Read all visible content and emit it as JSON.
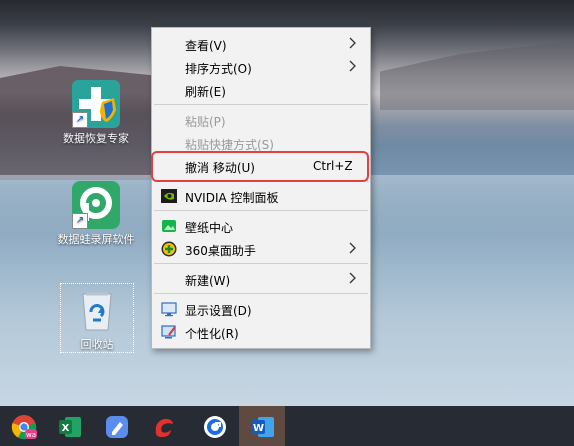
{
  "desktop_icons": [
    {
      "label": "数据恢复专家",
      "icon": "data-recovery-icon"
    },
    {
      "label": "数据蛙录屏软件",
      "icon": "screen-recorder-icon"
    },
    {
      "label": "回收站",
      "icon": "recycle-bin-icon"
    }
  ],
  "context_menu": {
    "view": "查看(V)",
    "sort": "排序方式(O)",
    "refresh": "刷新(E)",
    "paste": "粘贴(P)",
    "paste_shortcut": "粘贴快捷方式(S)",
    "undo_move": "撤消 移动(U)",
    "undo_shortcut": "Ctrl+Z",
    "nvidia": "NVIDIA 控制面板",
    "wallpaper": "壁纸中心",
    "assistant360": "360桌面助手",
    "new": "新建(W)",
    "display": "显示设置(D)",
    "personalize": "个性化(R)"
  },
  "taskbar": {
    "apps": [
      "chrome-icon",
      "excel-icon",
      "notes-icon",
      "wps-icon",
      "browser-icon",
      "word-icon"
    ],
    "active_app": "word-icon"
  },
  "colors": {
    "highlight_border": "#e04040",
    "menu_bg": "#f2f2f2",
    "taskbar_bg": "#272b33"
  }
}
